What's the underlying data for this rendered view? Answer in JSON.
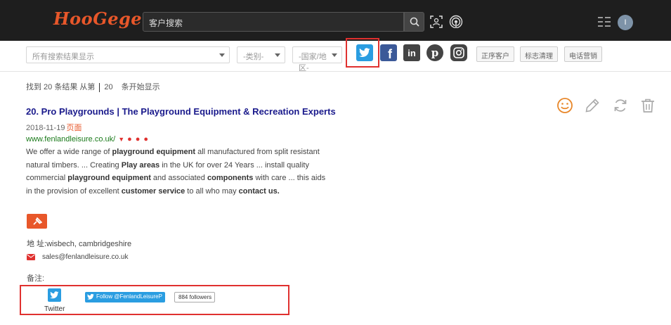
{
  "app": {
    "logo": "HooGege",
    "logo_mark": "®",
    "search_placeholder": "客户搜索",
    "avatar_letter": "I"
  },
  "filters": {
    "category_select": "所有搜索结果显示",
    "type_select": "-类别-",
    "region_select": "-国家/地区-",
    "buttons": [
      "正序客户",
      "标志清理",
      "电话营销"
    ]
  },
  "social_icons": [
    "twitter-icon",
    "facebook-icon",
    "linkedin-icon",
    "pinterest-icon",
    "instagram-icon"
  ],
  "results_summary": {
    "prefix": "找到 20 条结果  从第",
    "page": "20",
    "suffix": "条开始显示"
  },
  "result": {
    "title": "20. Pro Playgrounds | The Playground Equipment & Recreation Experts",
    "date": "2018-11-19",
    "snapshot": "页面",
    "url": "www.fenlandleisure.co.uk/",
    "description_segments": [
      {
        "t": "We offer a wide range of ",
        "b": false
      },
      {
        "t": "playground equipment",
        "b": true
      },
      {
        "t": " all manufactured from split resistant natural timbers. ... Creating ",
        "b": false
      },
      {
        "t": "Play areas",
        "b": true
      },
      {
        "t": " in the UK for over 24 Years ... install quality commercial ",
        "b": false
      },
      {
        "t": "playground equipment",
        "b": true
      },
      {
        "t": " and associated ",
        "b": false
      },
      {
        "t": "components",
        "b": true
      },
      {
        "t": " with care ... this aids in the provision of excellent ",
        "b": false
      },
      {
        "t": "customer service",
        "b": true
      },
      {
        "t": " to all who may ",
        "b": false
      },
      {
        "t": "contact",
        "b": true
      },
      {
        "t": " ",
        "b": false
      },
      {
        "t": "us.",
        "b": true
      }
    ],
    "address": "地 址:wisbech, cambridgeshire",
    "email": "sales@fenlandleisure.co.uk",
    "notes_label": "备注:"
  },
  "twitter_widget": {
    "label": "Twitter",
    "follow_label": "Follow @FenlandLeisureP",
    "followers": "884 followers"
  },
  "colors": {
    "brand": "#e8572a",
    "twitter": "#2a9de1",
    "facebook": "#3b5998",
    "linkedin": "#444444",
    "highlight": "#e0312f",
    "title": "#1a1a8c",
    "url": "#1a7a1a"
  }
}
